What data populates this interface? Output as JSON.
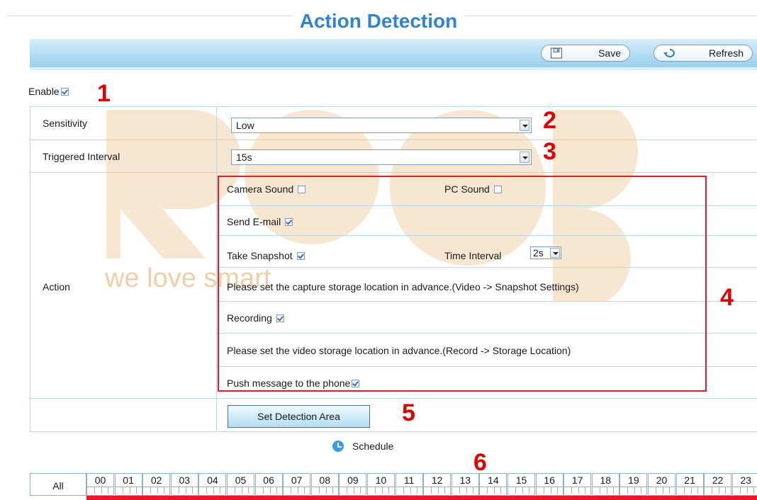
{
  "page": {
    "title": "Action Detection"
  },
  "toolbar": {
    "save_label": "Save",
    "refresh_label": "Refresh"
  },
  "enable": {
    "label": "Enable",
    "checked": true
  },
  "markers": [
    "1",
    "2",
    "3",
    "4",
    "5",
    "6"
  ],
  "form": {
    "sensitivity": {
      "label": "Sensitivity",
      "value": "Low"
    },
    "triggered_interval": {
      "label": "Triggered Interval",
      "value": "15s"
    },
    "action": {
      "label": "Action",
      "camera_sound": {
        "label": "Camera Sound",
        "checked": false
      },
      "pc_sound": {
        "label": "PC Sound",
        "checked": false
      },
      "send_email": {
        "label": "Send E-mail",
        "checked": true
      },
      "take_snapshot": {
        "label": "Take Snapshot",
        "checked": true
      },
      "time_interval": {
        "label": "Time Interval",
        "value": "2s"
      },
      "snapshot_note": "Please set the capture storage location in advance.(Video -> Snapshot Settings)",
      "recording": {
        "label": "Recording",
        "checked": true
      },
      "recording_note": "Please set the video storage location in advance.(Record -> Storage Location)",
      "push_message": {
        "label": "Push message to the phone",
        "checked": true
      }
    },
    "set_detection_area_label": "Set Detection Area"
  },
  "schedule": {
    "label": "Schedule",
    "all_label": "All",
    "hours": [
      "00",
      "01",
      "02",
      "03",
      "04",
      "05",
      "06",
      "07",
      "08",
      "09",
      "10",
      "11",
      "12",
      "13",
      "14",
      "15",
      "16",
      "17",
      "18",
      "19",
      "20",
      "21",
      "22",
      "23"
    ]
  },
  "watermark": {
    "text": "we love smart"
  },
  "colors": {
    "title": "#2f83cf",
    "marker": "#e10000",
    "highlight_box": "#e8182a",
    "watermark": "#f2d9b8"
  }
}
